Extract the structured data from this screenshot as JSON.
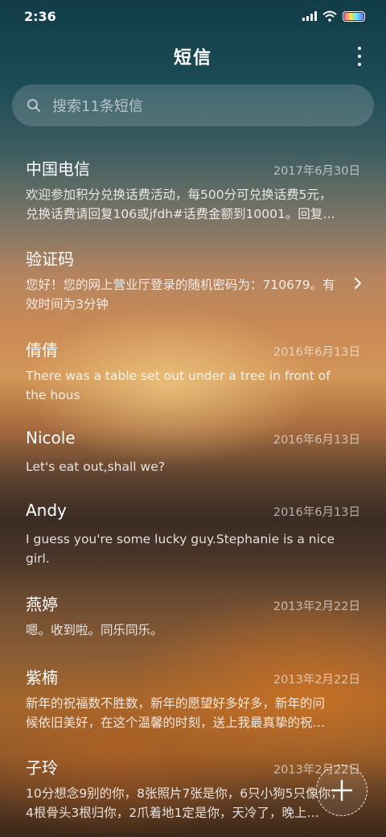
{
  "status": {
    "time": "2:36",
    "icons": [
      "signal-icon",
      "wifi-icon",
      "battery-icon"
    ],
    "battery_level": 1.0
  },
  "header": {
    "title": "短信",
    "more_icon": "more-vertical-icon"
  },
  "search": {
    "placeholder": "搜索11条短信",
    "icon": "search-icon"
  },
  "messages": [
    {
      "sender": "中国电信",
      "date": "2017年6月30日",
      "preview": "欢迎参加积分兑换话费活动，每500分可兑换话费5元，\n兑换话费请回复106或jfdh#话费金额到10001。回复…"
    },
    {
      "sender": "验证码",
      "date": "",
      "preview": "您好！您的网上营业厅登录的随机密码为：710679。有\n效时间为3分钟",
      "chevron": "chevron-right-icon"
    },
    {
      "sender": "倩倩",
      "date": "2016年6月13日",
      "preview": "There was a table set out under a tree in front of\nthe hous"
    },
    {
      "sender": "Nicole",
      "date": "2016年6月13日",
      "preview": "Let's eat out,shall we?"
    },
    {
      "sender": "Andy",
      "date": "2016年6月13日",
      "preview": "I guess you're some lucky guy.Stephanie is a nice\ngirl."
    },
    {
      "sender": "燕婷",
      "date": "2013年2月22日",
      "preview": "嗯。收到啦。同乐同乐。"
    },
    {
      "sender": "紫楠",
      "date": "2013年2月22日",
      "preview": "新年的祝福数不胜数，新年的愿望好多好多，新年的问\n候依旧美好，在这个温馨的时刻，送上我最真挚的祝…"
    },
    {
      "sender": "子玲",
      "date": "2013年2月22日",
      "preview": "10分想念9别的你，8张照片7张是你，6只小狗5只像你，\n4根骨头3根归你，2爪着地1定是你，天冷了，晚上…"
    }
  ],
  "fab": {
    "icon": "plus-icon"
  },
  "colors": {
    "text": "#ffffff",
    "secondary_text": "rgba(255,255,255,0.6)"
  }
}
